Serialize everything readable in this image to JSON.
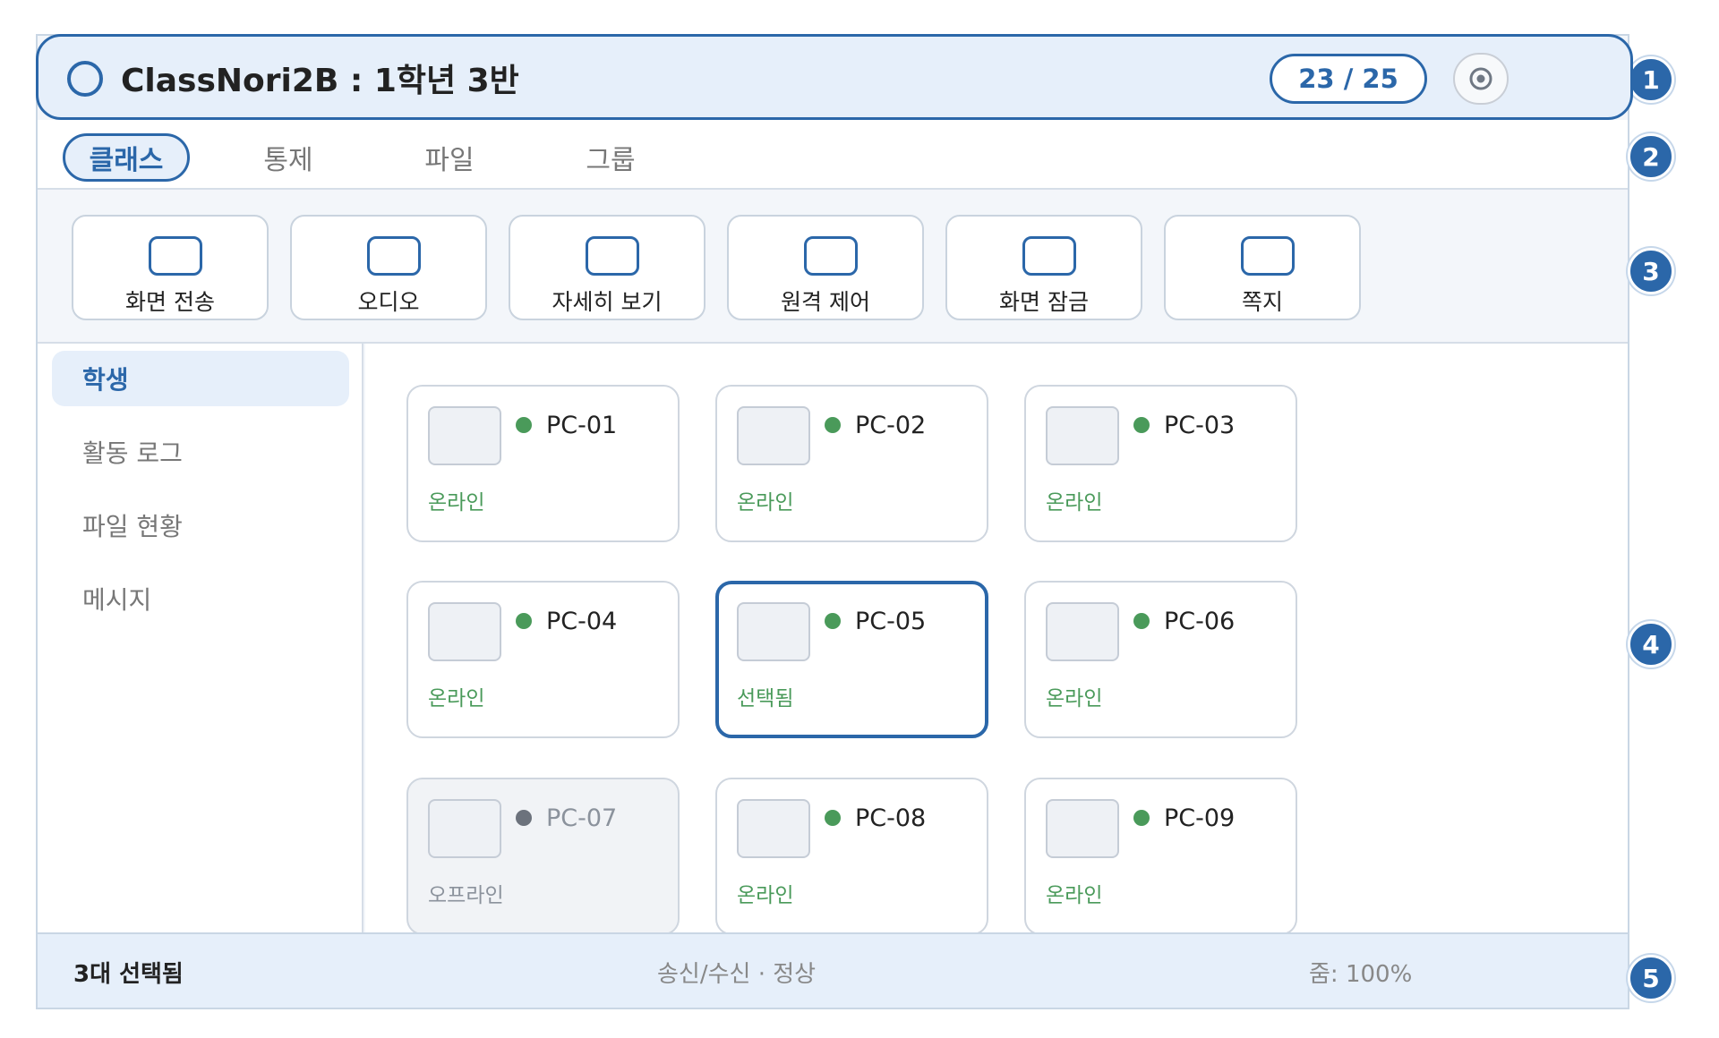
{
  "colors": {
    "accent": "#2b67a9",
    "online": "#4a9a5a",
    "offline": "#6c727c",
    "offline_text": "#8b929c"
  },
  "header": {
    "title": "ClassNori2B : 1학년 3반",
    "count": "23 / 25",
    "settings_icon": "target-icon",
    "status_icon": "ring-icon"
  },
  "tabs": [
    {
      "label": "클래스",
      "active": true
    },
    {
      "label": "통제",
      "active": false
    },
    {
      "label": "파일",
      "active": false
    },
    {
      "label": "그룹",
      "active": false
    }
  ],
  "actions": [
    {
      "label": "화면 전송",
      "icon": "monitor-icon"
    },
    {
      "label": "오디오",
      "icon": "monitor-icon"
    },
    {
      "label": "자세히 보기",
      "icon": "monitor-icon"
    },
    {
      "label": "원격 제어",
      "icon": "monitor-icon"
    },
    {
      "label": "화면 잠금",
      "icon": "monitor-icon"
    },
    {
      "label": "쪽지",
      "icon": "monitor-icon"
    }
  ],
  "sidebar": {
    "items": [
      {
        "label": "학생",
        "active": true
      },
      {
        "label": "활동 로그",
        "active": false
      },
      {
        "label": "파일 현황",
        "active": false
      },
      {
        "label": "메시지",
        "active": false
      }
    ]
  },
  "devices": [
    {
      "name": "PC-01",
      "status": "온라인",
      "state": "online"
    },
    {
      "name": "PC-02",
      "status": "온라인",
      "state": "online"
    },
    {
      "name": "PC-03",
      "status": "온라인",
      "state": "online"
    },
    {
      "name": "PC-04",
      "status": "온라인",
      "state": "online"
    },
    {
      "name": "PC-05",
      "status": "선택됨",
      "state": "selected"
    },
    {
      "name": "PC-06",
      "status": "온라인",
      "state": "online"
    },
    {
      "name": "PC-07",
      "status": "오프라인",
      "state": "offline"
    },
    {
      "name": "PC-08",
      "status": "온라인",
      "state": "online"
    },
    {
      "name": "PC-09",
      "status": "온라인",
      "state": "online"
    }
  ],
  "statusbar": {
    "selected": "3대 선택됨",
    "connection": "송신/수신 · 정상",
    "zoom": "줌: 100%"
  },
  "markers": [
    "1",
    "2",
    "3",
    "4",
    "5"
  ]
}
